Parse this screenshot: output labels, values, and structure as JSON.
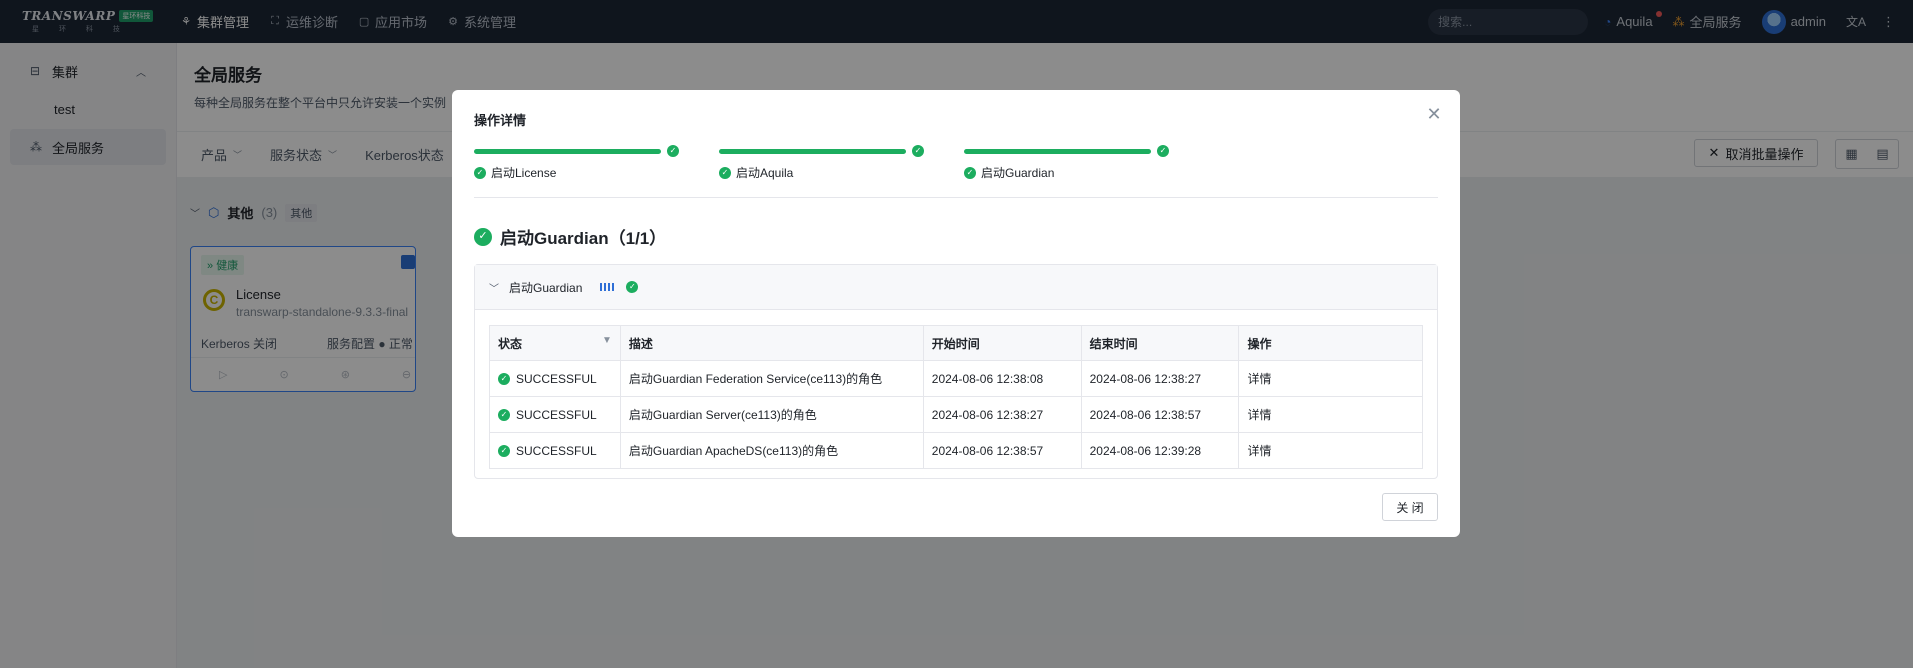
{
  "topbar": {
    "logo_text": "TRANSWARP",
    "logo_badge": "星环科技",
    "logo_sub": "星 环 科 技",
    "nav": [
      {
        "label": "集群管理",
        "icon": "cluster-icon"
      },
      {
        "label": "运维诊断",
        "icon": "diagnose-icon"
      },
      {
        "label": "应用市场",
        "icon": "market-icon"
      },
      {
        "label": "系统管理",
        "icon": "gear-icon"
      }
    ],
    "search_placeholder": "搜索...",
    "aquila_label": "Aquila",
    "global_services_label": "全局服务",
    "user_name": "admin"
  },
  "sidebar": {
    "items": [
      {
        "label": "集群"
      },
      {
        "label": "test"
      },
      {
        "label": "全局服务"
      }
    ]
  },
  "main": {
    "title": "全局服务",
    "description": "每种全局服务在整个平台中只允许安装一个实例",
    "filters": [
      "产品",
      "服务状态",
      "Kerberos状态"
    ],
    "cancel_batch_label": "取消批量操作",
    "group": {
      "title": "其他",
      "count": "(3)",
      "tag": "其他"
    },
    "card": {
      "health": "健康",
      "name": "License",
      "version": "transwarp-standalone-9.3.3-final",
      "kerberos": "Kerberos  关闭",
      "config": "服务配置 ● 正常"
    }
  },
  "modal": {
    "title": "操作详情",
    "steps": [
      {
        "label": "启动License",
        "progress": 1.0
      },
      {
        "label": "启动Aquila",
        "progress": 1.0
      },
      {
        "label": "启动Guardian",
        "progress": 1.0
      }
    ],
    "section_title": "启动Guardian（1/1）",
    "task_name": "启动Guardian",
    "table": {
      "headers": [
        "状态",
        "描述",
        "开始时间",
        "结束时间",
        "操作"
      ],
      "rows": [
        {
          "status": "SUCCESSFUL",
          "desc": "启动Guardian Federation Service(ce113)的角色",
          "start": "2024-08-06 12:38:08",
          "end": "2024-08-06 12:38:27",
          "action": "详情"
        },
        {
          "status": "SUCCESSFUL",
          "desc": "启动Guardian Server(ce113)的角色",
          "start": "2024-08-06 12:38:27",
          "end": "2024-08-06 12:38:57",
          "action": "详情"
        },
        {
          "status": "SUCCESSFUL",
          "desc": "启动Guardian ApacheDS(ce113)的角色",
          "start": "2024-08-06 12:38:57",
          "end": "2024-08-06 12:39:28",
          "action": "详情"
        }
      ]
    },
    "close_label": "关 闭"
  },
  "colors": {
    "success": "#1cad5f",
    "link": "#2f6fd6",
    "topbar": "#1d2736"
  }
}
